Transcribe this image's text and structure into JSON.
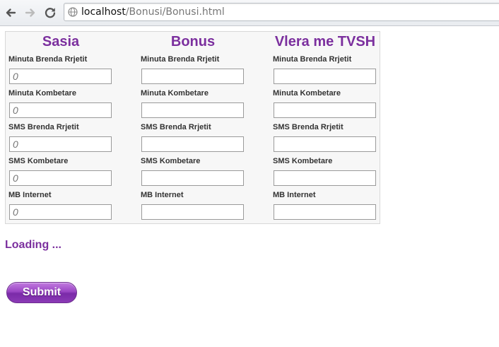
{
  "browser": {
    "url_host": "localhost",
    "url_path": "/Bonusi/Bonusi.html",
    "icons": [
      "back-arrow-icon",
      "forward-arrow-icon",
      "reload-icon",
      "globe-icon"
    ]
  },
  "form": {
    "columns": [
      {
        "title": "Sasia",
        "fields": [
          {
            "label": "Minuta Brenda Rrjetit",
            "value": "",
            "placeholder": "0"
          },
          {
            "label": "Minuta Kombetare",
            "value": "",
            "placeholder": "0"
          },
          {
            "label": "SMS Brenda Rrjetit",
            "value": "",
            "placeholder": "0"
          },
          {
            "label": "SMS Kombetare",
            "value": "",
            "placeholder": "0"
          },
          {
            "label": "MB Internet",
            "value": "",
            "placeholder": "0"
          }
        ]
      },
      {
        "title": "Bonus",
        "fields": [
          {
            "label": "Minuta Brenda Rrjetit",
            "value": ""
          },
          {
            "label": "Minuta Kombetare",
            "value": ""
          },
          {
            "label": "SMS Brenda Rrjetit",
            "value": ""
          },
          {
            "label": "SMS Kombetare",
            "value": ""
          },
          {
            "label": "MB Internet",
            "value": ""
          }
        ]
      },
      {
        "title": "Vlera me TVSH",
        "fields": [
          {
            "label": "Minuta Brenda Rrjetit",
            "value": ""
          },
          {
            "label": "Minuta Kombetare",
            "value": ""
          },
          {
            "label": "SMS Brenda Rrjetit",
            "value": ""
          },
          {
            "label": "SMS Kombetare",
            "value": ""
          },
          {
            "label": "MB Internet",
            "value": ""
          }
        ]
      }
    ]
  },
  "status": {
    "loading_text": "Loading ..."
  },
  "actions": {
    "submit_label": "Submit"
  },
  "colors": {
    "accent": "#7b2f9e",
    "panel_bg": "#f7f7f7"
  }
}
